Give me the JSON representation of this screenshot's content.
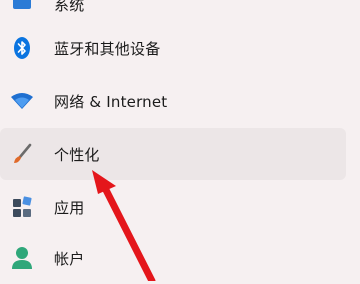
{
  "nav": {
    "items": [
      {
        "label": "系统",
        "icon": "system-icon"
      },
      {
        "label": "蓝牙和其他设备",
        "icon": "bluetooth-icon"
      },
      {
        "label": "网络 & Internet",
        "icon": "wifi-icon"
      },
      {
        "label": "个性化",
        "icon": "brush-icon",
        "active": true
      },
      {
        "label": "应用",
        "icon": "apps-icon"
      },
      {
        "label": "帐户",
        "icon": "account-icon"
      }
    ]
  },
  "colors": {
    "background": "#f6f0f1",
    "active_row": "#ece6e7",
    "bluetooth_blue": "#0a74e0",
    "arrow_red": "#e4161b"
  }
}
